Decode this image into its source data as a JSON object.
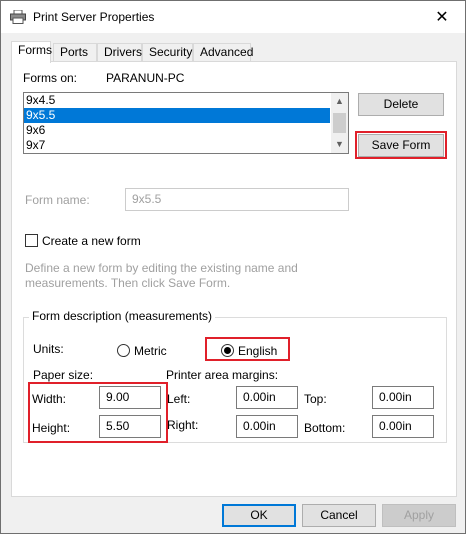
{
  "window": {
    "title": "Print Server Properties",
    "close_glyph": "✕"
  },
  "tabs": [
    {
      "label": "Forms",
      "active": true
    },
    {
      "label": "Ports",
      "active": false
    },
    {
      "label": "Drivers",
      "active": false
    },
    {
      "label": "Security",
      "active": false
    },
    {
      "label": "Advanced",
      "active": false
    }
  ],
  "forms_on": {
    "label": "Forms on:",
    "server": "PARANUN-PC"
  },
  "forms_list": {
    "items": [
      "9x4.5",
      "9x5.5",
      "9x6",
      "9x7"
    ],
    "selected": "9x5.5"
  },
  "buttons": {
    "delete": "Delete",
    "save_form": "Save Form",
    "ok": "OK",
    "cancel": "Cancel",
    "apply": "Apply"
  },
  "form_name": {
    "label": "Form name:",
    "value": "9x5.5"
  },
  "create_new_form": {
    "label": "Create a new form",
    "checked": false
  },
  "hint_text": {
    "line1": "Define a new form by editing the existing name and",
    "line2": "measurements. Then click Save Form."
  },
  "form_description": {
    "title": "Form description (measurements)",
    "units_label": "Units:",
    "metric_label": "Metric",
    "english_label": "English",
    "selected_unit": "English",
    "paper_size_label": "Paper size:",
    "width_label": "Width:",
    "width_value": "9.00",
    "height_label": "Height:",
    "height_value": "5.50",
    "margins_label": "Printer area margins:",
    "left_label": "Left:",
    "left_value": "0.00in",
    "right_label": "Right:",
    "right_value": "0.00in",
    "top_label": "Top:",
    "top_value": "0.00in",
    "bottom_label": "Bottom:",
    "bottom_value": "0.00in"
  },
  "colors": {
    "selection": "#0078d7",
    "highlight_box": "#e0202a"
  }
}
